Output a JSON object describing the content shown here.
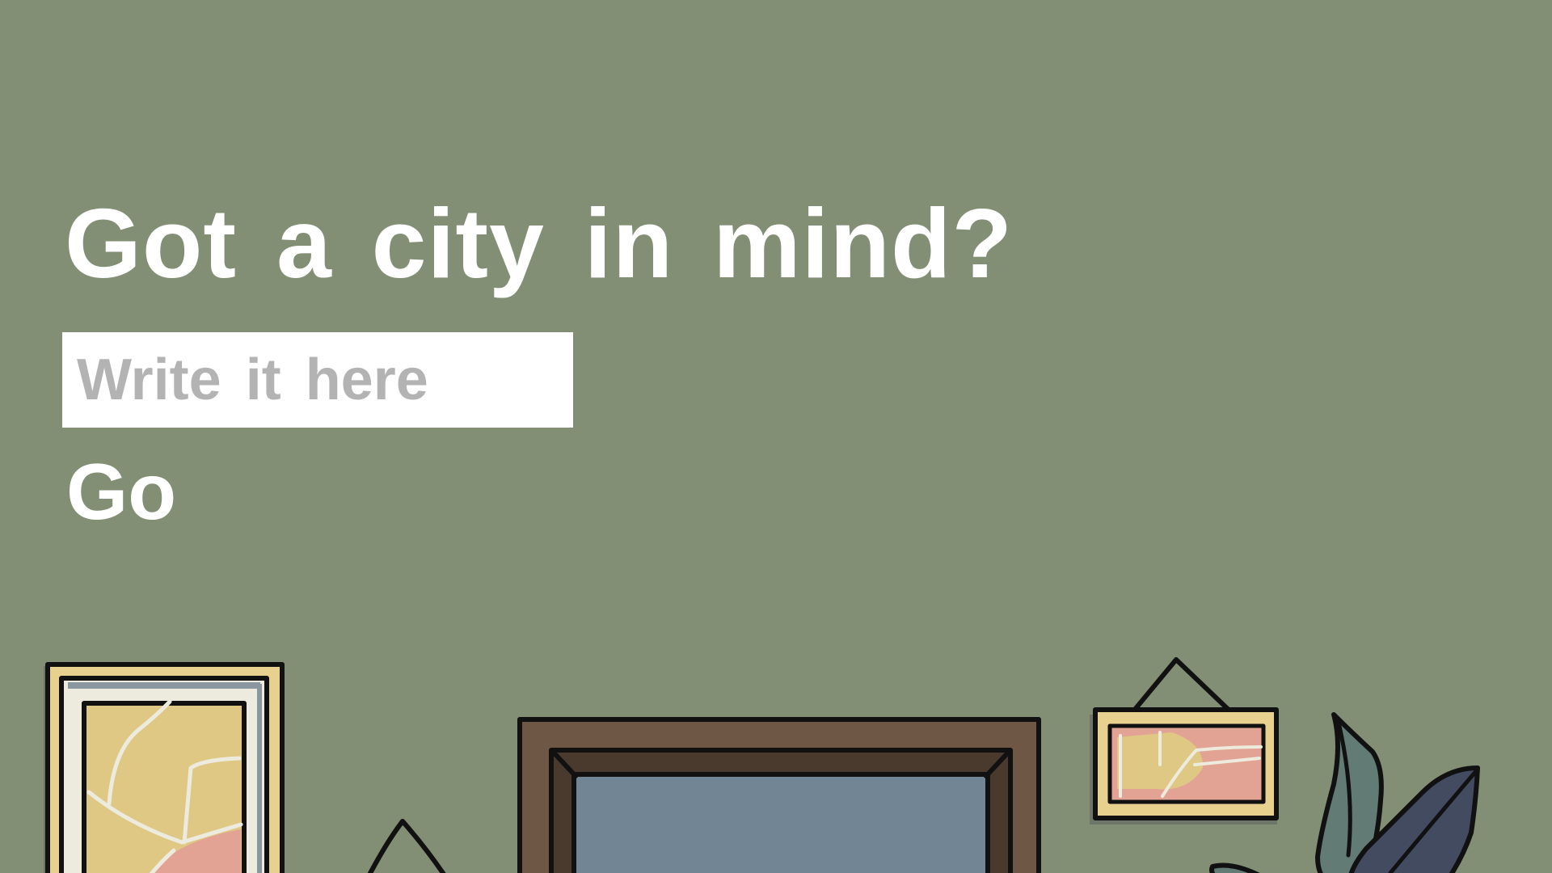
{
  "screen": {
    "prompt_title": "Got a city in mind?",
    "city_input": {
      "placeholder": "Write it here",
      "value": ""
    },
    "go_label": "Go"
  },
  "colors": {
    "background": "#828f75",
    "title_text": "#ffffff",
    "input_background": "#ffffff",
    "placeholder_text": "#b3b3b3",
    "frame_gold": "#e8d08f",
    "map_yellow": "#dfc784",
    "map_pink": "#e2a394",
    "wood_brown": "#6e5744",
    "window_blue": "#728594",
    "plant_teal": "#627b74",
    "plant_navy": "#434b61",
    "outline": "#111111"
  },
  "illustration": {
    "items": [
      "map-frame-left",
      "plant-left",
      "window",
      "map-frame-hanging",
      "plant-right"
    ]
  }
}
